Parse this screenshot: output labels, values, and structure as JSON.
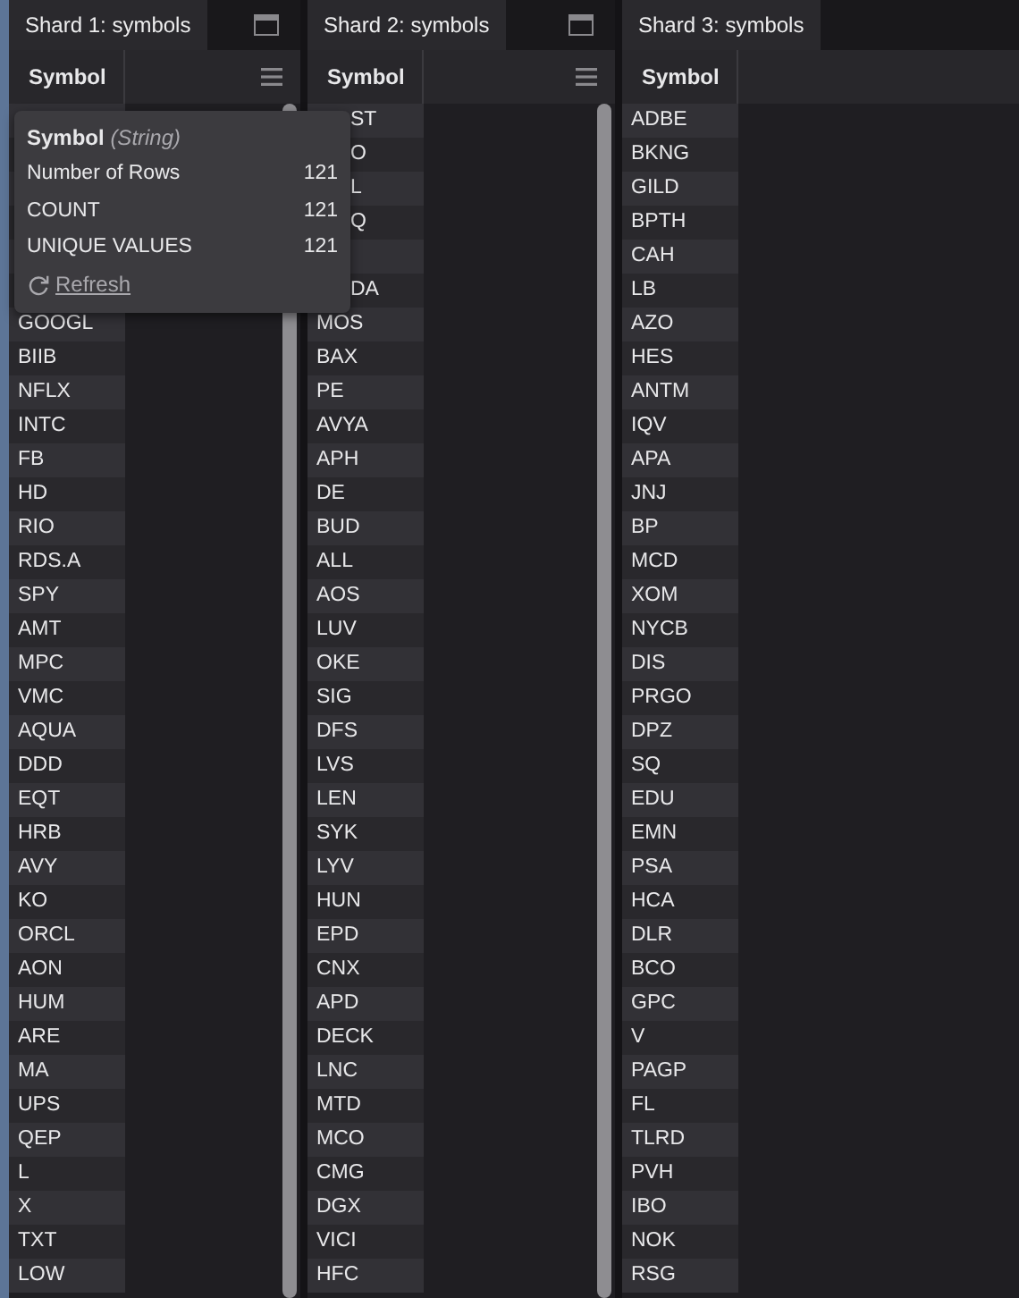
{
  "shards": [
    {
      "tab": "Shard 1: symbols",
      "window_button": true,
      "column": "Symbol",
      "menu_button": true,
      "scrollbar": true,
      "rows": [
        {
          "covered": true
        },
        {
          "covered": true
        },
        {
          "covered": true
        },
        {
          "covered": true
        },
        {
          "covered": true
        },
        {
          "covered": true
        },
        {
          "symbol": "GOOGL"
        },
        {
          "symbol": "BIIB"
        },
        {
          "symbol": "NFLX"
        },
        {
          "symbol": "INTC"
        },
        {
          "symbol": "FB"
        },
        {
          "symbol": "HD"
        },
        {
          "symbol": "RIO"
        },
        {
          "symbol": "RDS.A"
        },
        {
          "symbol": "SPY"
        },
        {
          "symbol": "AMT"
        },
        {
          "symbol": "MPC"
        },
        {
          "symbol": "VMC"
        },
        {
          "symbol": "AQUA"
        },
        {
          "symbol": "DDD"
        },
        {
          "symbol": "EQT"
        },
        {
          "symbol": "HRB"
        },
        {
          "symbol": "AVY"
        },
        {
          "symbol": "KO"
        },
        {
          "symbol": "ORCL"
        },
        {
          "symbol": "AON"
        },
        {
          "symbol": "HUM"
        },
        {
          "symbol": "ARE"
        },
        {
          "symbol": "MA"
        },
        {
          "symbol": "UPS"
        },
        {
          "symbol": "QEP"
        },
        {
          "symbol": "L"
        },
        {
          "symbol": "X"
        },
        {
          "symbol": "TXT"
        },
        {
          "symbol": "LOW"
        }
      ]
    },
    {
      "tab": "Shard 2: symbols",
      "window_button": true,
      "column": "Symbol",
      "menu_button": true,
      "scrollbar": true,
      "rows": [
        {
          "symbol": "ST",
          "covered": true
        },
        {
          "symbol": "O",
          "covered": true
        },
        {
          "symbol": "L",
          "covered": true
        },
        {
          "symbol": "Q",
          "covered": true
        },
        {
          "covered": true
        },
        {
          "symbol": "DA",
          "covered": true
        },
        {
          "symbol": "MOS"
        },
        {
          "symbol": "BAX"
        },
        {
          "symbol": "PE"
        },
        {
          "symbol": "AVYA"
        },
        {
          "symbol": "APH"
        },
        {
          "symbol": "DE"
        },
        {
          "symbol": "BUD"
        },
        {
          "symbol": "ALL"
        },
        {
          "symbol": "AOS"
        },
        {
          "symbol": "LUV"
        },
        {
          "symbol": "OKE"
        },
        {
          "symbol": "SIG"
        },
        {
          "symbol": "DFS"
        },
        {
          "symbol": "LVS"
        },
        {
          "symbol": "LEN"
        },
        {
          "symbol": "SYK"
        },
        {
          "symbol": "LYV"
        },
        {
          "symbol": "HUN"
        },
        {
          "symbol": "EPD"
        },
        {
          "symbol": "CNX"
        },
        {
          "symbol": "APD"
        },
        {
          "symbol": "DECK"
        },
        {
          "symbol": "LNC"
        },
        {
          "symbol": "MTD"
        },
        {
          "symbol": "MCO"
        },
        {
          "symbol": "CMG"
        },
        {
          "symbol": "DGX"
        },
        {
          "symbol": "VICI"
        },
        {
          "symbol": "HFC"
        }
      ]
    },
    {
      "tab": "Shard 3: symbols",
      "window_button": false,
      "column": "Symbol",
      "menu_button": false,
      "scrollbar": false,
      "rows": [
        {
          "symbol": "ADBE"
        },
        {
          "symbol": "BKNG"
        },
        {
          "symbol": "GILD"
        },
        {
          "symbol": "BPTH"
        },
        {
          "symbol": "CAH"
        },
        {
          "symbol": "LB"
        },
        {
          "symbol": "AZO"
        },
        {
          "symbol": "HES"
        },
        {
          "symbol": "ANTM"
        },
        {
          "symbol": "IQV"
        },
        {
          "symbol": "APA"
        },
        {
          "symbol": "JNJ"
        },
        {
          "symbol": "BP"
        },
        {
          "symbol": "MCD"
        },
        {
          "symbol": "XOM"
        },
        {
          "symbol": "NYCB"
        },
        {
          "symbol": "DIS"
        },
        {
          "symbol": "PRGO"
        },
        {
          "symbol": "DPZ"
        },
        {
          "symbol": "SQ"
        },
        {
          "symbol": "EDU"
        },
        {
          "symbol": "EMN"
        },
        {
          "symbol": "PSA"
        },
        {
          "symbol": "HCA"
        },
        {
          "symbol": "DLR"
        },
        {
          "symbol": "BCO"
        },
        {
          "symbol": "GPC"
        },
        {
          "symbol": "V"
        },
        {
          "symbol": "PAGP"
        },
        {
          "symbol": "FL"
        },
        {
          "symbol": "TLRD"
        },
        {
          "symbol": "PVH"
        },
        {
          "symbol": "IBO"
        },
        {
          "symbol": "NOK"
        },
        {
          "symbol": "RSG"
        }
      ]
    }
  ],
  "tooltip": {
    "title": "Symbol",
    "type": "(String)",
    "stats": [
      {
        "label": "Number of Rows",
        "value": "121"
      },
      {
        "label": "COUNT",
        "value": "121"
      },
      {
        "label": "UNIQUE VALUES",
        "value": "121"
      }
    ],
    "refresh": "Refresh"
  }
}
